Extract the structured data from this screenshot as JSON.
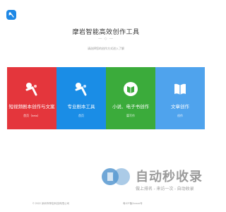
{
  "hero": {
    "title": "摩岩智能高效创作工具",
    "divider": "— ◇ —",
    "subtitle": "请选择您的创作方式进入了解"
  },
  "cards": [
    {
      "label": "短视频剧本创作与文案",
      "sub": "首页（beta）",
      "color": "#e4363c",
      "icon": "figure-icon"
    },
    {
      "label": "专业剧本工具",
      "sub": "首页",
      "color": "#1a8de6",
      "icon": "figure-icon"
    },
    {
      "label": "小说、电子书创作",
      "sub": "篇写作",
      "color": "#3bab3b",
      "icon": "book-icon"
    },
    {
      "label": "文章创作",
      "sub": "创作",
      "color": "#4fa3ed",
      "icon": "book-open-icon"
    }
  ],
  "footer": {
    "copyright": "© 2022 深圳市摩岩科技有限公司",
    "icp": "粤ICP备2xxxxx号"
  },
  "watermark": {
    "title": "自动秒收录",
    "line": "做上排名 - 来访一次 - 自动收录"
  }
}
